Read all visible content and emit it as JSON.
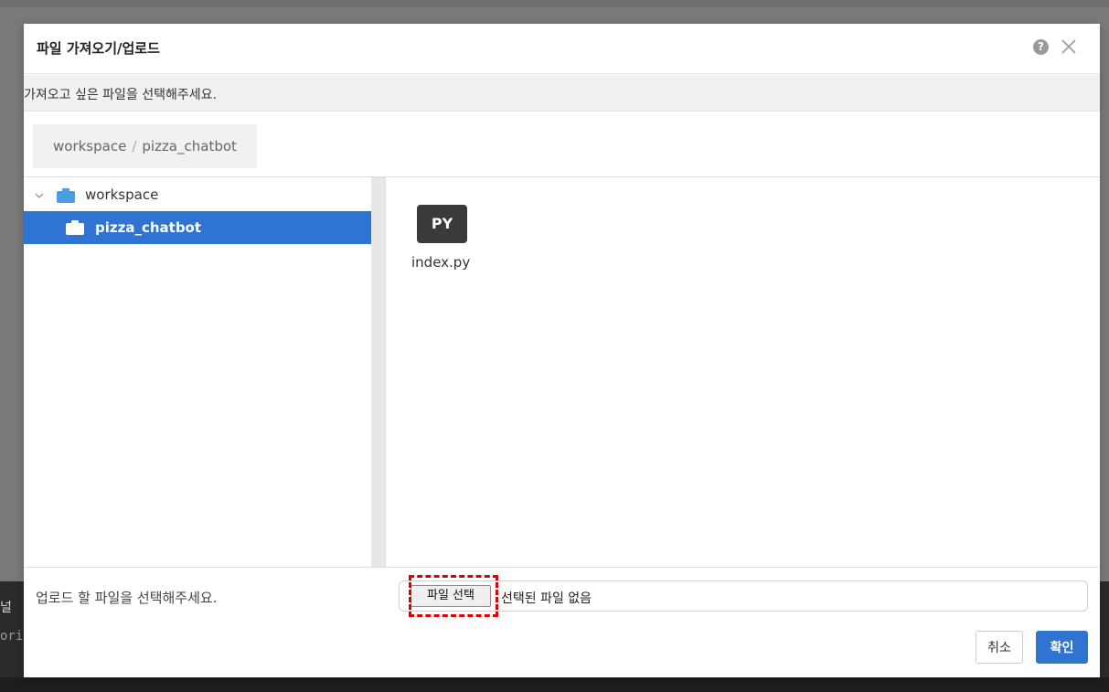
{
  "backdrop": {
    "line1": "널",
    "line2": "ori"
  },
  "dialog": {
    "title": "파일 가져오기/업로드",
    "help_glyph": "?",
    "instruction": "가져오고 싶은 파일을 선택해주세요.",
    "breadcrumb": {
      "root": "workspace",
      "separator": "/",
      "current": "pizza_chatbot"
    },
    "tree": {
      "items": [
        {
          "label": "workspace",
          "expanded": true,
          "selected": false
        },
        {
          "label": "pizza_chatbot",
          "selected": true
        }
      ]
    },
    "files": [
      {
        "badge": "PY",
        "name": "index.py"
      }
    ],
    "upload": {
      "label": "업로드 할 파일을 선택해주세요.",
      "choose_button": "파일 선택",
      "status": "선택된 파일 없음"
    },
    "buttons": {
      "cancel": "취소",
      "confirm": "확인"
    }
  },
  "colors": {
    "accent": "#2f74d0",
    "folder_icon": "#4a9fe3",
    "highlight": "#e00000",
    "py_badge": "#3a3a3a"
  }
}
